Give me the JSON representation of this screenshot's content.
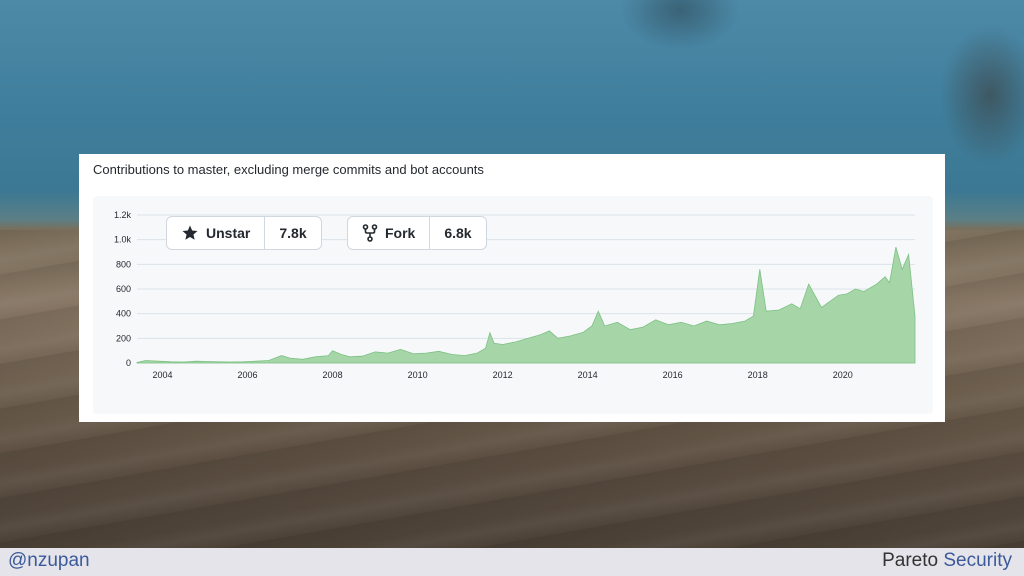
{
  "caption": "Contributions to master, excluding merge commits and bot accounts",
  "star_button": {
    "label": "Unstar",
    "count": "7.8k",
    "icon": "star-icon"
  },
  "fork_button": {
    "label": "Fork",
    "count": "6.8k",
    "icon": "fork-icon"
  },
  "footer": {
    "handle": "@nzupan",
    "brand_a": "Pareto",
    "brand_b": "Security"
  },
  "colors": {
    "area_fill": "#a6d6a8",
    "area_stroke": "#7cc183",
    "grid": "#dbe3ea"
  },
  "chart_data": {
    "type": "area",
    "title": "",
    "xlabel": "",
    "ylabel": "",
    "ylim": [
      0,
      1200
    ],
    "xlim": [
      2003.4,
      2021.7
    ],
    "y_ticks": [
      0,
      200,
      400,
      600,
      800,
      1000,
      1200
    ],
    "y_tick_labels": [
      "0",
      "200",
      "400",
      "600",
      "800",
      "1.0k",
      "1.2k"
    ],
    "x_ticks": [
      2004,
      2006,
      2008,
      2010,
      2012,
      2014,
      2016,
      2018,
      2020
    ],
    "x_tick_labels": [
      "2004",
      "2006",
      "2008",
      "2010",
      "2012",
      "2014",
      "2016",
      "2018",
      "2020"
    ],
    "grid": true,
    "series": [
      {
        "x": [
          2003.4,
          2003.6,
          2003.9,
          2004.2,
          2004.5,
          2004.8,
          2005.0,
          2005.3,
          2005.6,
          2005.9,
          2006.2,
          2006.5,
          2006.8,
          2007.0,
          2007.3,
          2007.6,
          2007.9,
          2008.0,
          2008.2,
          2008.4,
          2008.7,
          2009.0,
          2009.3,
          2009.6,
          2009.9,
          2010.2,
          2010.5,
          2010.8,
          2011.1,
          2011.4,
          2011.6,
          2011.7,
          2011.8,
          2012.0,
          2012.3,
          2012.6,
          2012.9,
          2013.1,
          2013.3,
          2013.6,
          2013.9,
          2014.1,
          2014.25,
          2014.4,
          2014.7,
          2015.0,
          2015.3,
          2015.6,
          2015.9,
          2016.2,
          2016.5,
          2016.8,
          2017.1,
          2017.4,
          2017.7,
          2017.9,
          2018.05,
          2018.2,
          2018.5,
          2018.8,
          2019.0,
          2019.2,
          2019.5,
          2019.7,
          2019.9,
          2020.1,
          2020.3,
          2020.5,
          2020.8,
          2021.0,
          2021.1,
          2021.25,
          2021.4,
          2021.55,
          2021.7
        ],
        "y": [
          5,
          20,
          15,
          10,
          8,
          15,
          12,
          10,
          8,
          10,
          15,
          20,
          60,
          40,
          30,
          50,
          60,
          100,
          70,
          50,
          55,
          90,
          80,
          110,
          75,
          80,
          95,
          70,
          60,
          80,
          120,
          245,
          160,
          150,
          170,
          200,
          230,
          260,
          200,
          220,
          250,
          300,
          420,
          300,
          330,
          270,
          290,
          350,
          310,
          330,
          300,
          340,
          310,
          320,
          340,
          380,
          760,
          420,
          430,
          480,
          440,
          640,
          450,
          500,
          550,
          560,
          600,
          580,
          640,
          700,
          650,
          940,
          760,
          880,
          380
        ]
      }
    ]
  }
}
